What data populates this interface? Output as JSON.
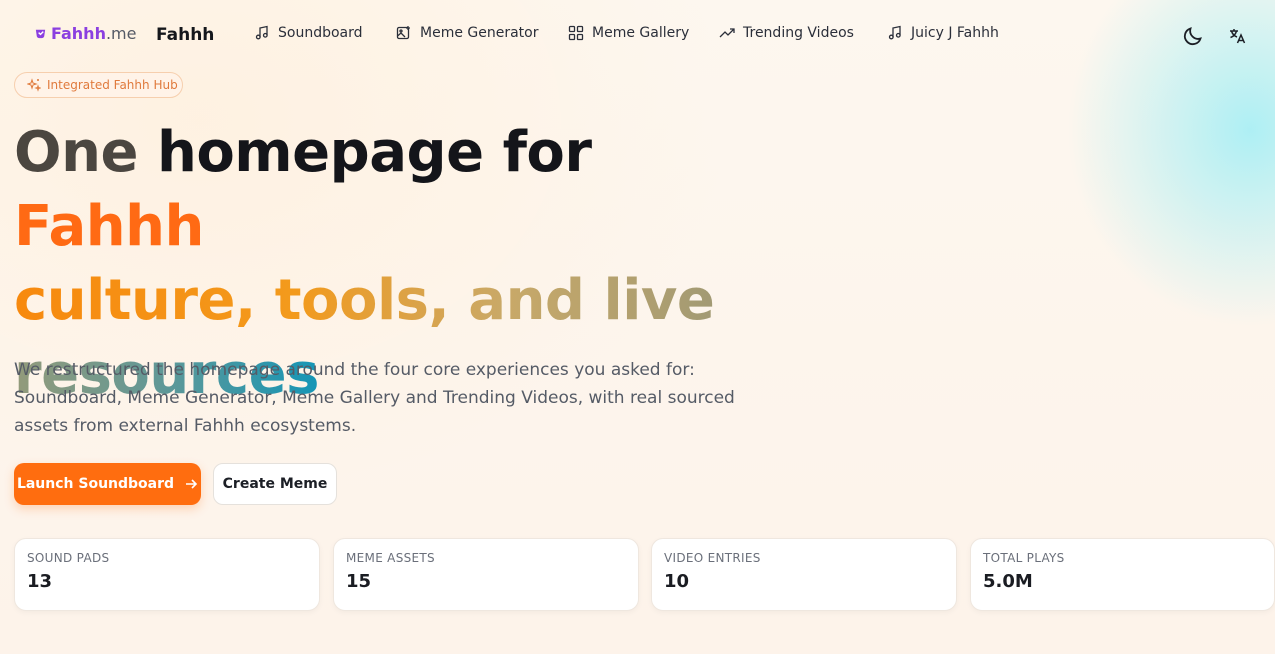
{
  "nav": {
    "logo_brand": "Fahhh",
    "logo_tld": ".me",
    "site_name": "Fahhh",
    "items": [
      {
        "label": "Soundboard",
        "icon": "music-note-icon"
      },
      {
        "label": "Meme Generator",
        "icon": "image-edit-icon"
      },
      {
        "label": "Meme Gallery",
        "icon": "grid-icon"
      },
      {
        "label": "Trending Videos",
        "icon": "trending-up-icon"
      },
      {
        "label": "Juicy J Fahhh",
        "icon": "music-note-icon"
      }
    ],
    "theme_toggle_icon": "moon-icon",
    "language_icon": "translate-icon"
  },
  "hero": {
    "badge": "Integrated Fahhh Hub",
    "headline": {
      "part1_dim": "One ",
      "part1": "homepage for ",
      "accent": "Fahhh",
      "line2": "culture, tools, and live",
      "line3": "resources"
    },
    "lead": "We restructured the homepage around the four core experiences you asked for: Soundboard, Meme Generator, Meme Gallery and Trending Videos, with real sourced assets from external Fahhh ecosystems.",
    "primary_button": "Launch Soundboard",
    "secondary_button": "Create Meme"
  },
  "stats": [
    {
      "label": "SOUND PADS",
      "value": "13"
    },
    {
      "label": "MEME ASSETS",
      "value": "15"
    },
    {
      "label": "VIDEO ENTRIES",
      "value": "10"
    },
    {
      "label": "TOTAL PLAYS",
      "value": "5.0M"
    }
  ],
  "colors": {
    "accent": "#ff6d0f",
    "brand_purple": "#8b3fe0",
    "teal": "#1596b6"
  }
}
